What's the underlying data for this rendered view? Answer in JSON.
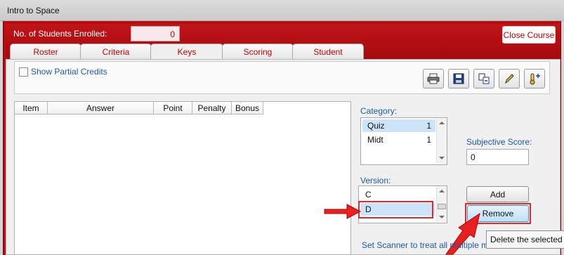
{
  "window": {
    "title": "Intro to Space"
  },
  "header": {
    "enrolled_label": "No. of Students Enrolled:",
    "enrolled_value": "0",
    "close_course_label": "Close Course"
  },
  "tabs": [
    {
      "label": "Roster"
    },
    {
      "label": "Criteria"
    },
    {
      "label": "Keys",
      "active": true
    },
    {
      "label": "Scoring"
    },
    {
      "label": "Student"
    }
  ],
  "toolbar": {
    "show_partial_credits_label": "Show Partial Credits",
    "show_partial_credits_checked": false,
    "buttons": [
      {
        "icon": "printer-icon"
      },
      {
        "icon": "save-icon"
      },
      {
        "icon": "copy-swap-icon"
      },
      {
        "icon": "pencil-icon"
      },
      {
        "icon": "thermometer-plus-icon"
      }
    ]
  },
  "grid": {
    "columns": [
      "Item",
      "Answer",
      "Point",
      "Penalty",
      "Bonus"
    ]
  },
  "category": {
    "label": "Category:",
    "items": [
      {
        "name": "Quiz",
        "value": "1",
        "selected": true
      },
      {
        "name": "Midt",
        "value": "1",
        "selected": false
      }
    ]
  },
  "subjective": {
    "label": "Subjective Score:",
    "value": "0"
  },
  "version": {
    "label": "Version:",
    "items": [
      {
        "name": "C",
        "selected": false
      },
      {
        "name": "D",
        "selected": true
      }
    ]
  },
  "buttons": {
    "add_label": "Add",
    "remove_label": "Remove"
  },
  "tooltip": {
    "text": "Delete the selected"
  },
  "scanner_link": "Set Scanner to treat all multiple m",
  "colors": {
    "accent_red": "#b50d10",
    "link_blue": "#1c5aa3",
    "annotation_red": "#e02a2a"
  }
}
